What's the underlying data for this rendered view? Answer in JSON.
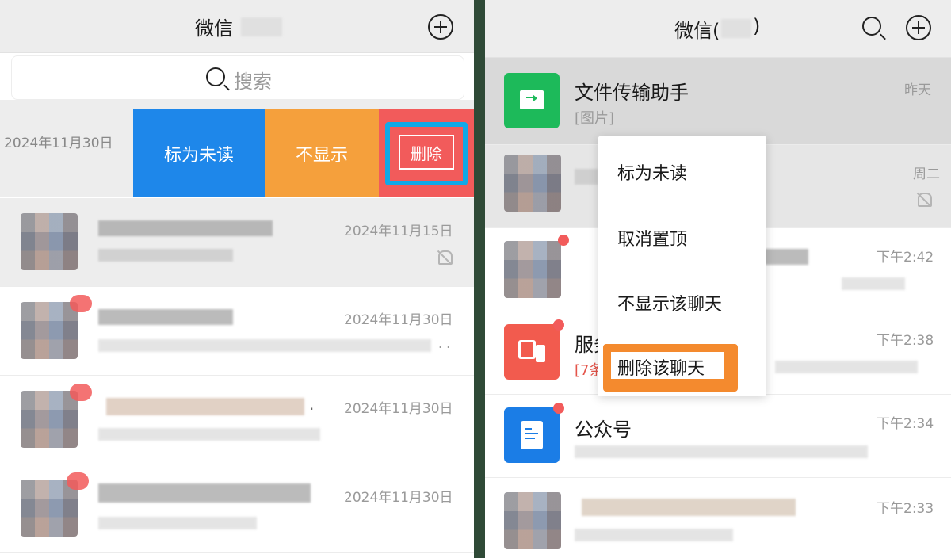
{
  "left": {
    "header": {
      "title": "微信"
    },
    "search": {
      "placeholder": "搜索"
    },
    "swiped_row": {
      "time": "2024年11月30日",
      "actions": {
        "mark_unread": "标为未读",
        "hide": "不显示",
        "delete": "删除"
      }
    },
    "rows": [
      {
        "time": "2024年11月15日",
        "muted": true
      },
      {
        "time": "2024年11月30日",
        "trailing": ". ."
      },
      {
        "time": "2024年11月30日",
        "trailing": "."
      },
      {
        "time": "2024年11月30日"
      }
    ]
  },
  "right": {
    "header": {
      "title": "微信(",
      "title_suffix": ")"
    },
    "rows": [
      {
        "name": "文件传输助手",
        "preview": "[图片]",
        "time": "昨天"
      },
      {
        "time": "周二",
        "muted": true
      },
      {
        "time": "下午2:42"
      },
      {
        "name": "服务",
        "preview": "[7条",
        "time": "下午2:38"
      },
      {
        "name": "公众号",
        "time": "下午2:34"
      },
      {
        "time": "下午2:33"
      }
    ],
    "context_menu": {
      "items": [
        "标为未读",
        "取消置顶",
        "不显示该聊天",
        "删除该聊天"
      ]
    }
  },
  "colors": {
    "action_blue": "#1e87ea",
    "action_orange": "#f5a03c",
    "action_red": "#f25b5b",
    "highlight_blue": "#11a9e8",
    "highlight_orange": "#f48a2e",
    "wechat_green": "#1dba5a",
    "service_red": "#f25b4e",
    "official_blue": "#1b7de6"
  },
  "icons": {
    "add": "plus-circle-icon",
    "search": "search-icon",
    "mute": "bell-off-icon",
    "file_transfer": "folder-arrow-icon",
    "service": "service-message-icon",
    "official_account": "document-icon"
  }
}
